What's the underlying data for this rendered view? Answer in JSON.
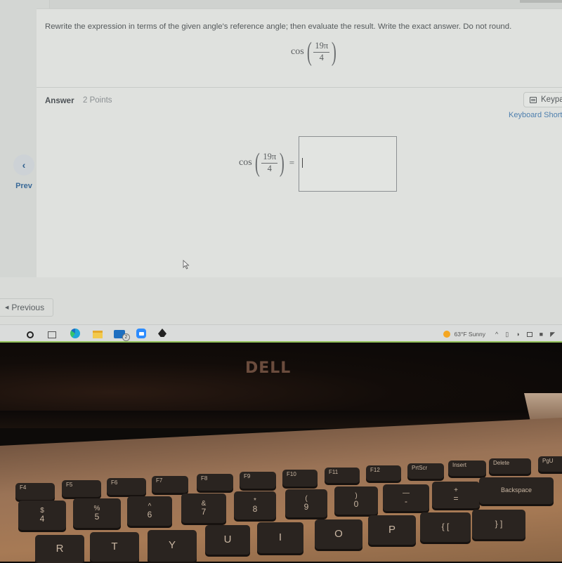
{
  "question": {
    "instruction": "Rewrite the expression in terms of the given angle's reference angle; then evaluate the result. Write the exact answer. Do not round.",
    "expression": {
      "function": "cos",
      "numerator": "19π",
      "denominator": "4"
    }
  },
  "answer": {
    "label": "Answer",
    "points": "2 Points",
    "keypad_label": "Keypa",
    "shortcuts_label": "Keyboard Shortc",
    "expression": {
      "function": "cos",
      "numerator": "19π",
      "denominator": "4",
      "equals": "="
    },
    "input_value": "",
    "input_placeholder": ""
  },
  "navigation": {
    "prev_side_icon": "chevron-left-icon",
    "prev_side_label": "Prev",
    "previous_button_label": "Previous"
  },
  "taskbar": {
    "apps": [
      "search",
      "task-view",
      "edge",
      "file-explorer",
      "mail",
      "zoom",
      "inkscape"
    ],
    "mail_badge": "2",
    "weather": "63°F  Sunny",
    "tray_chevron": "^"
  },
  "laptop": {
    "brand": "DELL",
    "keys": {
      "function_row": [
        "F4",
        "F5",
        "F6",
        "F7",
        "F8",
        "F9",
        "F10",
        "F11",
        "F12",
        "PrtScr",
        "Insert",
        "Delete",
        "PgU"
      ],
      "number_row": [
        {
          "top": "$",
          "bottom": "4"
        },
        {
          "top": "%",
          "bottom": "5"
        },
        {
          "top": "^",
          "bottom": "6"
        },
        {
          "top": "&",
          "bottom": "7"
        },
        {
          "top": "*",
          "bottom": "8"
        },
        {
          "top": "(",
          "bottom": "9"
        },
        {
          "top": ")",
          "bottom": "0"
        },
        {
          "top": "—",
          "bottom": "-"
        },
        {
          "top": "+",
          "bottom": "="
        },
        {
          "top": "",
          "bottom": "Backspace"
        }
      ],
      "letter_row": [
        "R",
        "T",
        "Y",
        "U",
        "I",
        "O",
        "P",
        "{ [",
        "} ]"
      ]
    }
  }
}
